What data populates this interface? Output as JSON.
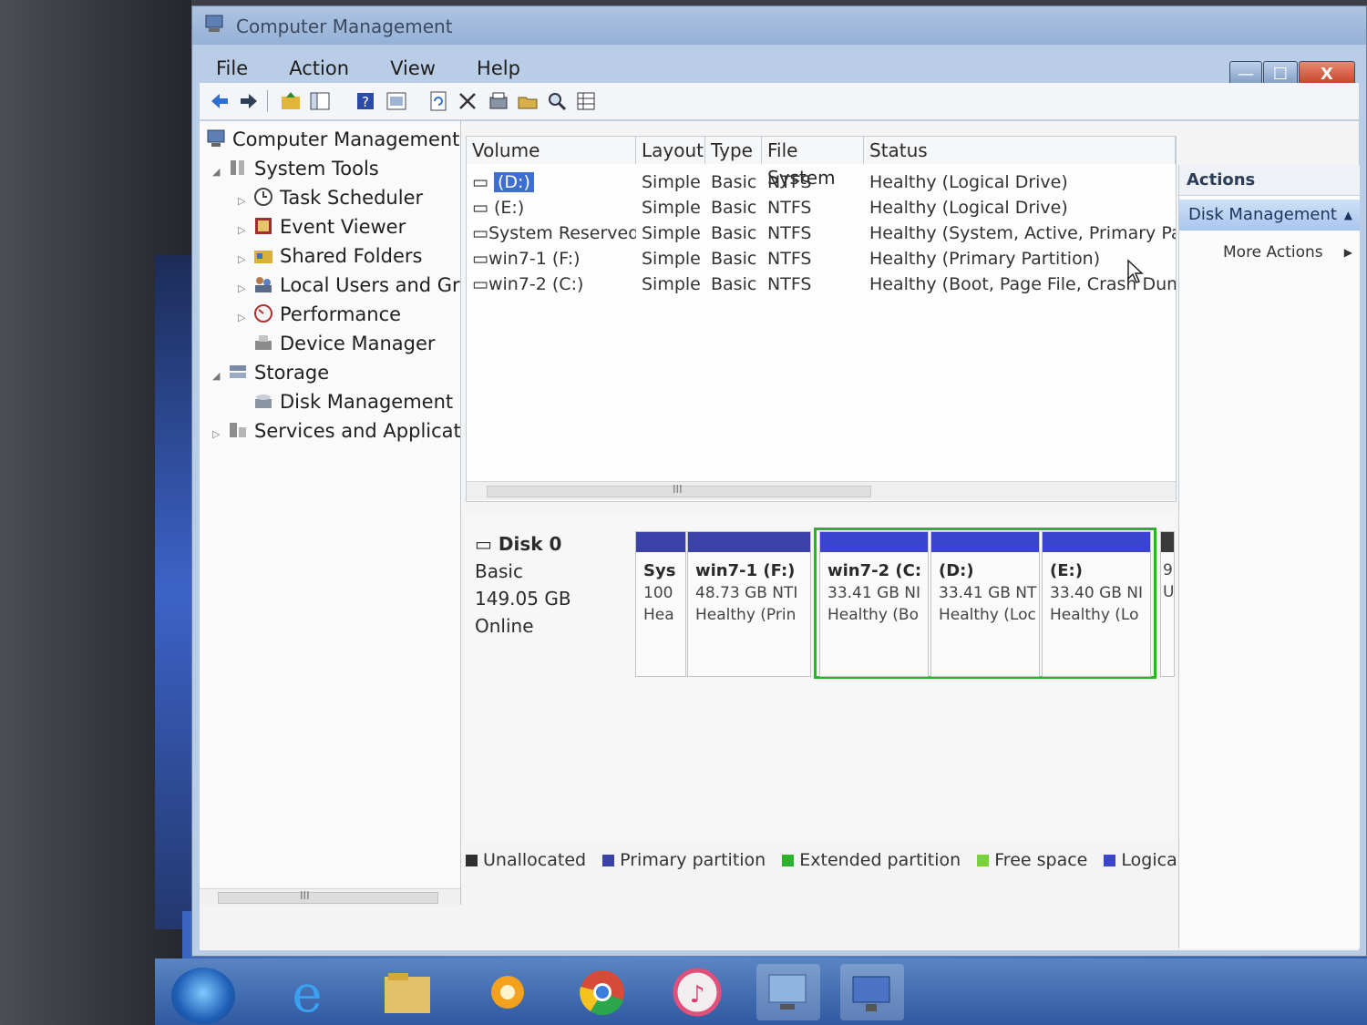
{
  "window": {
    "title": "Computer Management",
    "controls": {
      "minimize": "—",
      "maximize": "☐",
      "close": "X"
    }
  },
  "menu": [
    "File",
    "Action",
    "View",
    "Help"
  ],
  "toolbar_icons": [
    "back-arrow-icon",
    "forward-arrow-icon",
    "up-folder-icon",
    "console-tree-icon",
    "help-icon",
    "properties-icon",
    "refresh-icon",
    "delete-icon",
    "disk-props-icon",
    "open-icon",
    "search-icon",
    "view-icon"
  ],
  "tree": {
    "root": "Computer Management",
    "items": [
      {
        "label": "System Tools",
        "level": 1,
        "expander": "◢"
      },
      {
        "label": "Task Scheduler",
        "level": 2,
        "expander": "▷"
      },
      {
        "label": "Event Viewer",
        "level": 2,
        "expander": "▷"
      },
      {
        "label": "Shared Folders",
        "level": 2,
        "expander": "▷"
      },
      {
        "label": "Local Users and Gr",
        "level": 2,
        "expander": "▷"
      },
      {
        "label": "Performance",
        "level": 2,
        "expander": "▷"
      },
      {
        "label": "Device Manager",
        "level": 2,
        "expander": ""
      },
      {
        "label": "Storage",
        "level": 1,
        "expander": "◢"
      },
      {
        "label": "Disk Management",
        "level": 2,
        "expander": ""
      },
      {
        "label": "Services and Applicat",
        "level": 1,
        "expander": "▷"
      }
    ],
    "scroll_marker": "III"
  },
  "volumes": {
    "columns": [
      "Volume",
      "Layout",
      "Type",
      "File System",
      "Status"
    ],
    "rows": [
      {
        "volume": "(D:)",
        "layout": "Simple",
        "type": "Basic",
        "fs": "NTFS",
        "status": "Healthy (Logical Drive)",
        "selected": true
      },
      {
        "volume": "(E:)",
        "layout": "Simple",
        "type": "Basic",
        "fs": "NTFS",
        "status": "Healthy (Logical Drive)"
      },
      {
        "volume": "System Reserved",
        "layout": "Simple",
        "type": "Basic",
        "fs": "NTFS",
        "status": "Healthy (System, Active, Primary Partitic"
      },
      {
        "volume": "win7-1 (F:)",
        "layout": "Simple",
        "type": "Basic",
        "fs": "NTFS",
        "status": "Healthy (Primary Partition)"
      },
      {
        "volume": "win7-2 (C:)",
        "layout": "Simple",
        "type": "Basic",
        "fs": "NTFS",
        "status": "Healthy (Boot, Page File, Crash Dump, L"
      }
    ],
    "scroll_marker": "III"
  },
  "disk": {
    "name": "Disk 0",
    "type": "Basic",
    "size": "149.05 GB",
    "status": "Online",
    "partitions": [
      {
        "label": "Sys",
        "size": "100",
        "status": "Hea",
        "color": "#3a42a8"
      },
      {
        "label": "win7-1  (F:)",
        "size": "48.73 GB NTI",
        "status": "Healthy (Prin",
        "color": "#3a42a8"
      },
      {
        "label": "win7-2  (C:",
        "size": "33.41 GB NI",
        "status": "Healthy (Bo",
        "color": "#3b44cf"
      },
      {
        "label": "(D:)",
        "size": "33.41 GB NT",
        "status": "Healthy (Loc",
        "color": "#3b44cf"
      },
      {
        "label": "(E:)",
        "size": "33.40 GB NI",
        "status": "Healthy (Lo",
        "color": "#3b44cf"
      },
      {
        "label": "",
        "size": "9",
        "status": "U",
        "color": "#3a3a3a"
      }
    ]
  },
  "legend": [
    {
      "label": "Unallocated",
      "color": "#303030"
    },
    {
      "label": "Primary partition",
      "color": "#3a42a8"
    },
    {
      "label": "Extended partition",
      "color": "#2cb32c"
    },
    {
      "label": "Free space",
      "color": "#7ad23a"
    },
    {
      "label": "Logical drive",
      "color": "#3b44cf"
    }
  ],
  "actions": {
    "header": "Actions",
    "section": "Disk Management",
    "item": "More Actions"
  },
  "taskbar_icons": [
    "start-orb-icon",
    "internet-explorer-icon",
    "file-explorer-icon",
    "media-player-icon",
    "chrome-icon",
    "itunes-icon",
    "network-icon",
    "computer-management-icon"
  ]
}
